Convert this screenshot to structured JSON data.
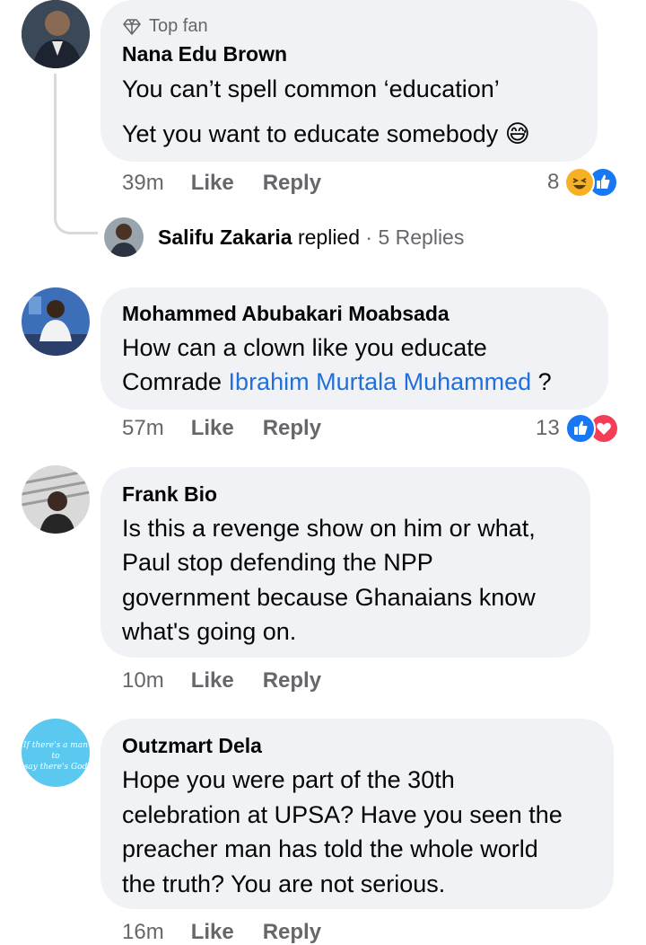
{
  "comments": [
    {
      "badge": "Top fan",
      "author": "Nana Edu Brown",
      "lines": [
        "You can’t spell common ‘education’",
        "Yet you want to educate somebody 😅"
      ],
      "time": "39m",
      "like": "Like",
      "reply": "Reply",
      "reaction_count": "8",
      "reactions": [
        "haha-icon",
        "like-icon"
      ]
    },
    {
      "author": "Mohammed Abubakari Moabsada",
      "line1": "How can a clown like you educate",
      "line2_prefix": "Comrade ",
      "mention": "Ibrahim Murtala Muhammed",
      "line2_suffix": " ?",
      "time": "57m",
      "like": "Like",
      "reply": "Reply",
      "reaction_count": "13",
      "reactions": [
        "like-icon",
        "love-icon"
      ]
    },
    {
      "author": "Frank Bio",
      "lines": [
        "Is this a revenge show on him or what,",
        "Paul stop defending the NPP",
        "government because Ghanaians know",
        "what's going on."
      ],
      "time": "10m",
      "like": "Like",
      "reply": "Reply"
    },
    {
      "author": "Outzmart Dela",
      "lines": [
        "Hope you were part of the 30th",
        "celebration at UPSA? Have you seen the",
        "preacher man has told the whole world",
        "the truth? You are not serious."
      ],
      "time": "16m",
      "like": "Like",
      "reply": "Reply",
      "avatar_text": [
        "If there's a man to",
        "say there's God"
      ]
    }
  ],
  "reply_summary": {
    "author": "Salifu Zakaria",
    "verb": " replied",
    "count": " · 5 Replies"
  },
  "colors": {
    "bubble": "#f0f2f5",
    "link": "#216fdb",
    "like": "#1877f2",
    "love": "#f33e58",
    "haha": "#f7b125"
  }
}
